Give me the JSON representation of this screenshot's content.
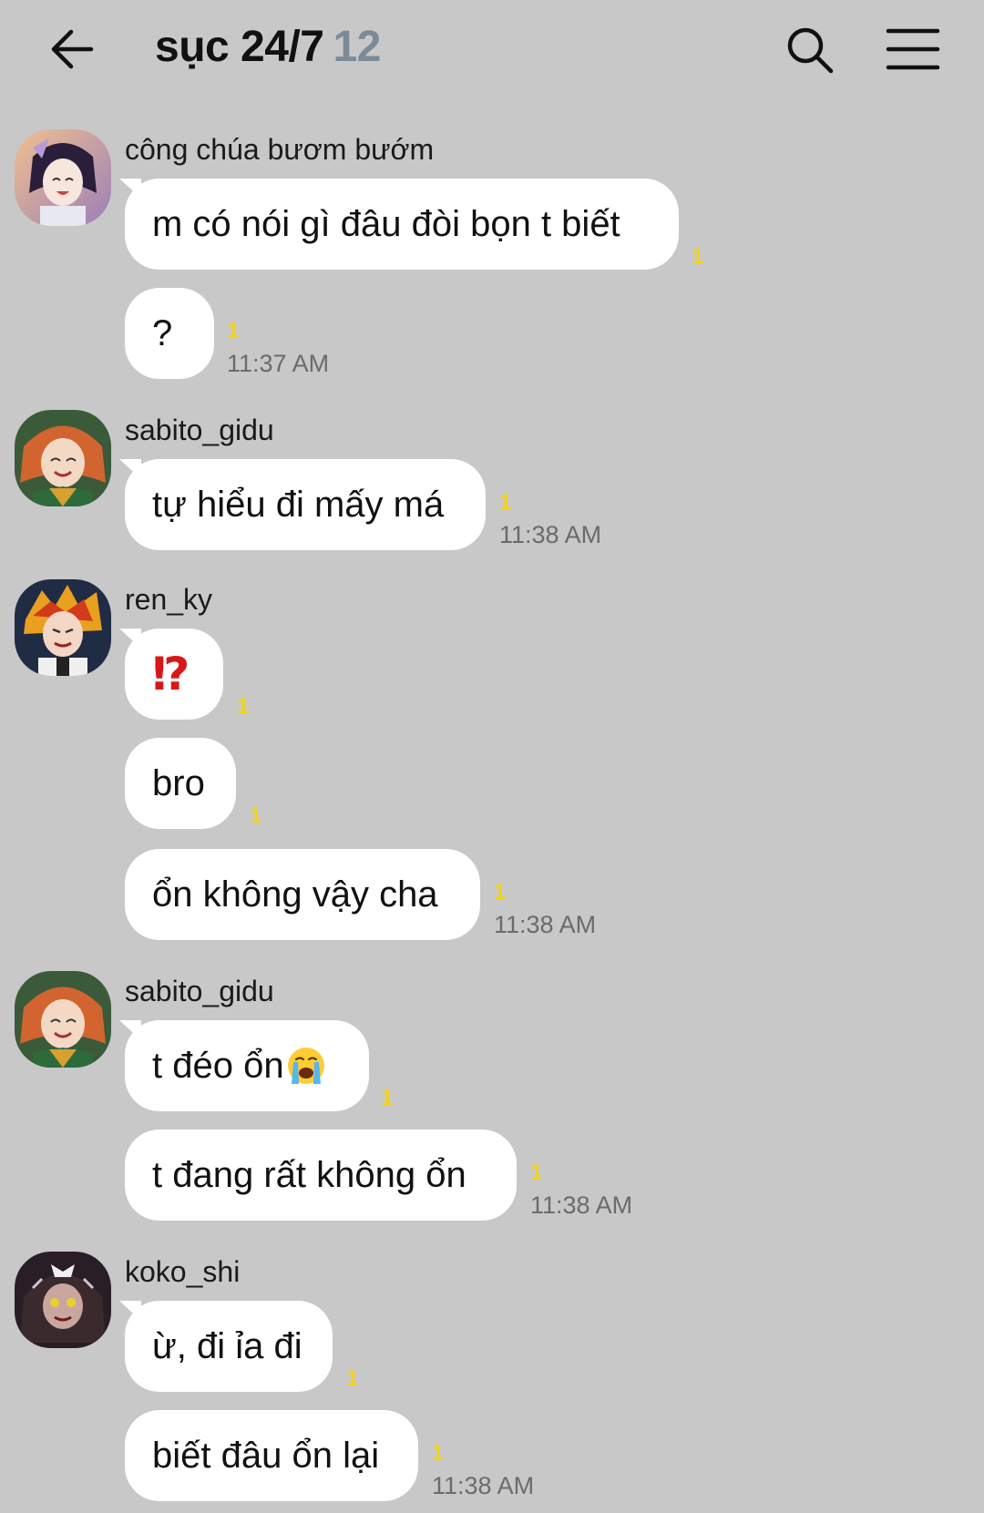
{
  "header": {
    "title": "sục 24/7",
    "member_count": "12"
  },
  "messages": [
    {
      "sender": "công chúa bươm bướm",
      "bubbles": [
        {
          "text": "m có nói gì đâu đòi bọn t biết",
          "unread": "1"
        },
        {
          "text": "?",
          "unread": "1",
          "time": "11:37 AM"
        }
      ]
    },
    {
      "sender": "sabito_gidu",
      "bubbles": [
        {
          "text": "tự hiểu đi mấy má",
          "unread": "1",
          "time": "11:38 AM"
        }
      ]
    },
    {
      "sender": "ren_ky",
      "bubbles": [
        {
          "text": "⁉",
          "unread": "1"
        },
        {
          "text": "bro",
          "unread": "1"
        },
        {
          "text": "ổn không vậy cha",
          "unread": "1",
          "time": "11:38 AM"
        }
      ]
    },
    {
      "sender": "sabito_gidu",
      "bubbles": [
        {
          "text": "t đéo ổn",
          "emoji": "loudly-crying-face",
          "unread": "1"
        },
        {
          "text": "t đang rất không ổn",
          "unread": "1",
          "time": "11:38 AM"
        }
      ]
    },
    {
      "sender": "koko_shi",
      "bubbles": [
        {
          "text": "ừ, đi ỉa đi",
          "unread": "1"
        },
        {
          "text": "biết đâu ổn lại",
          "unread": "1",
          "time": "11:38 AM"
        }
      ]
    }
  ],
  "icons": {
    "back": "arrow-left-icon",
    "search": "search-icon",
    "menu": "hamburger-menu-icon"
  },
  "colors": {
    "background": "#c8c8c8",
    "bubble": "#ffffff",
    "unread_badge": "#f2d21a",
    "member_count": "#7a8a96",
    "timestamp": "#6b6b6b",
    "interrobang": "#d81818"
  }
}
